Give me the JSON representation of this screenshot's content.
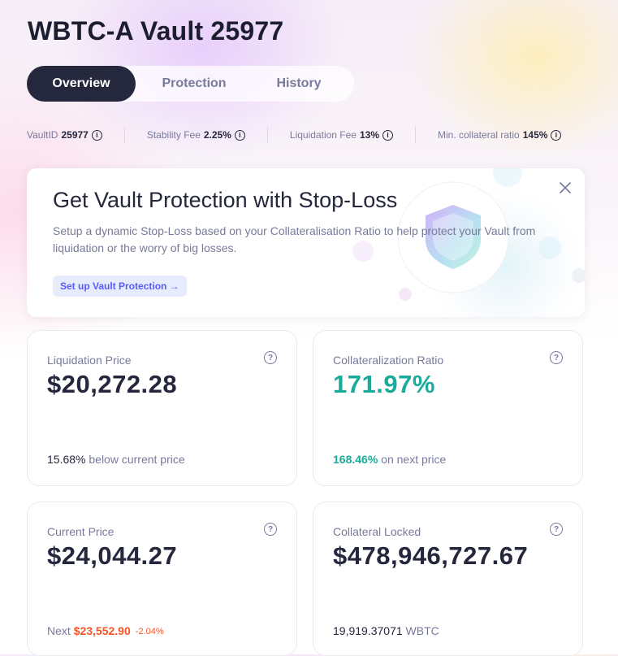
{
  "title": "WBTC-A Vault 25977",
  "tabs": [
    {
      "label": "Overview",
      "active": true
    },
    {
      "label": "Protection",
      "active": false
    },
    {
      "label": "History",
      "active": false
    }
  ],
  "stats": [
    {
      "label": "VaultID",
      "value": "25977"
    },
    {
      "label": "Stability Fee",
      "value": "2.25%"
    },
    {
      "label": "Liquidation Fee",
      "value": "13%"
    },
    {
      "label": "Min. collateral ratio",
      "value": "145%"
    }
  ],
  "banner": {
    "title": "Get Vault Protection with Stop-Loss",
    "description": "Setup a dynamic Stop-Loss based on your Collateralisation Ratio to help protect your Vault from liquidation or the worry of big losses.",
    "button_label": "Set up Vault Protection →"
  },
  "cards": {
    "liquidation_price": {
      "label": "Liquidation Price",
      "value": "$20,272.28",
      "foot_value": "15.68%",
      "foot_text": " below current price"
    },
    "collateralization_ratio": {
      "label": "Collateralization Ratio",
      "value": "171.97%",
      "foot_value": "168.46%",
      "foot_text": " on next price"
    },
    "current_price": {
      "label": "Current Price",
      "value": "$24,044.27",
      "foot_prefix": "Next ",
      "foot_value": "$23,552.90",
      "foot_change": "-2.04%"
    },
    "collateral_locked": {
      "label": "Collateral Locked",
      "value": "$478,946,727.67",
      "foot_value": "19,919.37071",
      "foot_text": " WBTC"
    }
  },
  "colors": {
    "primary_dark": "#25273d",
    "muted": "#787a9b",
    "success": "#1aab9b",
    "warning": "#f75524",
    "link": "#575cfe"
  },
  "icons": {
    "info": "info-icon",
    "help": "question-icon",
    "close": "close-icon",
    "shield": "shield-icon"
  }
}
